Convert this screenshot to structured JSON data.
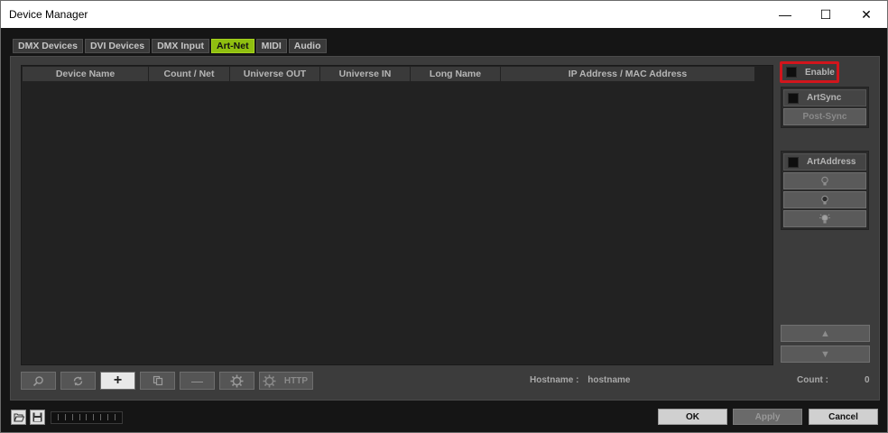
{
  "window": {
    "title": "Device Manager",
    "minimize_glyph": "—",
    "maximize_glyph": "☐",
    "close_glyph": "✕"
  },
  "tabs": [
    {
      "label": "DMX Devices",
      "active": false
    },
    {
      "label": "DVI Devices",
      "active": false
    },
    {
      "label": "DMX Input",
      "active": false
    },
    {
      "label": "Art-Net",
      "active": true
    },
    {
      "label": "MIDI",
      "active": false
    },
    {
      "label": "Audio",
      "active": false
    }
  ],
  "table": {
    "columns": [
      "Device Name",
      "Count / Net",
      "Universe OUT",
      "Universe IN",
      "Long Name",
      "IP Address / MAC Address"
    ],
    "rows": []
  },
  "toolbar": {
    "search_icon": "search-icon",
    "refresh_icon": "refresh-icon",
    "add_label": "+",
    "copy_icon": "copy-icon",
    "remove_label": "—",
    "settings_icon": "gear-icon",
    "http_label": "HTTP"
  },
  "status": {
    "hostname_label": "Hostname :",
    "hostname_value": "hostname",
    "count_label": "Count :",
    "count_value": "0"
  },
  "right_panel": {
    "enable_label": "Enable",
    "enable_checked": false,
    "artsync_label": "ArtSync",
    "artsync_checked": false,
    "postsync_label": "Post-Sync",
    "artaddress_label": "ArtAddress",
    "artaddress_checked": false,
    "led_buttons": [
      "led-normal-icon",
      "led-mute-icon",
      "led-locate-icon"
    ],
    "up_glyph": "▲",
    "down_glyph": "▼"
  },
  "bottom": {
    "ok_label": "OK",
    "apply_label": "Apply",
    "cancel_label": "Cancel"
  },
  "colors": {
    "active_tab": "#8fbf10",
    "highlight": "#d2151c",
    "panel": "#3c3c3c",
    "table_bg": "#222222"
  }
}
